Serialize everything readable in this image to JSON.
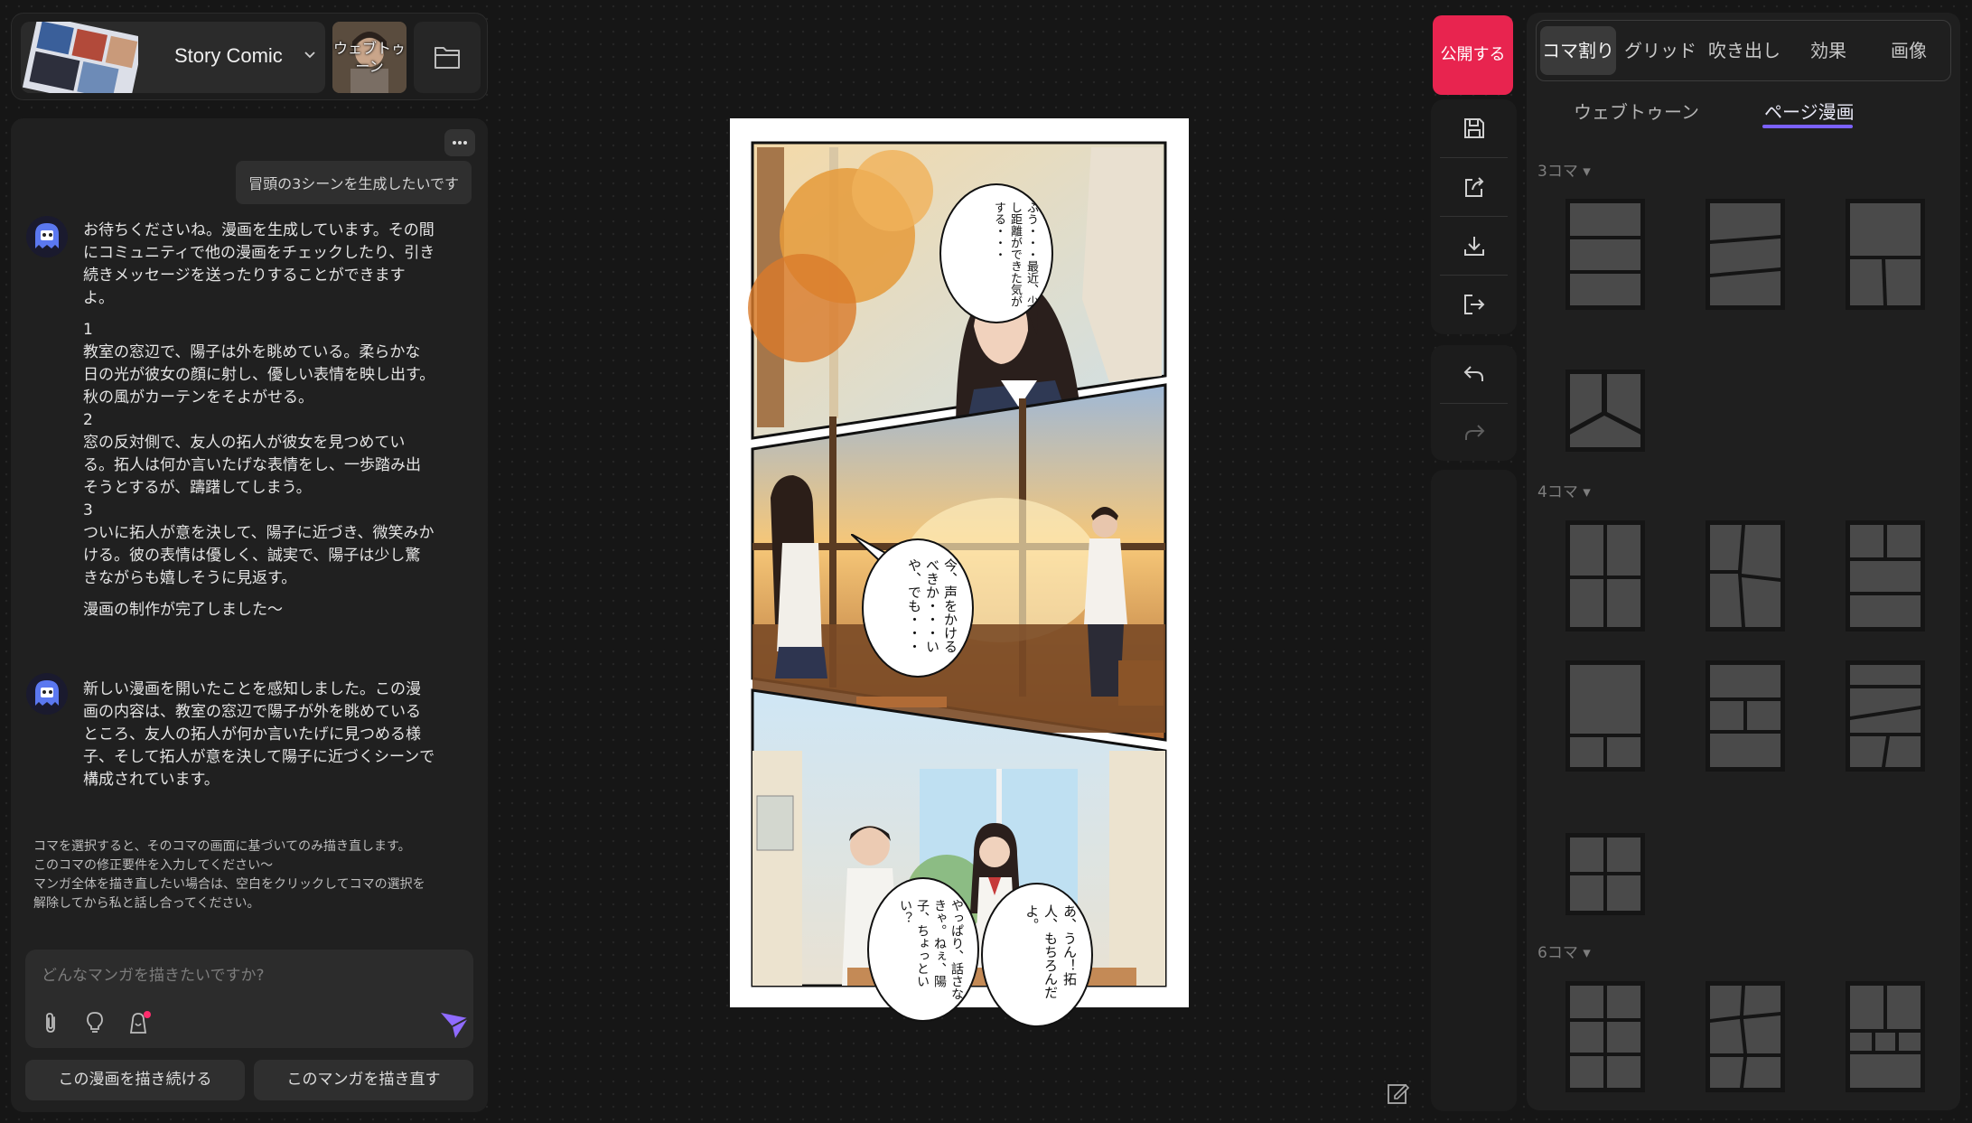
{
  "topbar": {
    "project_name": "Story Comic",
    "mode_label": "ウェブトゥーン"
  },
  "chat": {
    "user_message": "冒頭の3シーンを生成したいです",
    "bot_message_1": {
      "intro": "お待ちくださいね。漫画を生成しています。その間にコミュニティで他の漫画をチェックしたり、引き続きメッセージを送ったりすることができますよ。",
      "steps": [
        "1",
        "教室の窓辺で、陽子は外を眺めている。柔らかな日の光が彼女の顔に射し、優しい表情を映し出す。秋の風がカーテンをそよがせる。",
        "2",
        "窓の反対側で、友人の拓人が彼女を見つめている。拓人は何か言いたげな表情をし、一歩踏み出そうとするが、躊躇してしまう。",
        "3",
        "ついに拓人が意を決して、陽子に近づき、微笑みかける。彼の表情は優しく、誠実で、陽子は少し驚きながらも嬉しそうに見返す。"
      ],
      "done": "漫画の制作が完了しました～"
    },
    "bot_message_2": "新しい漫画を開いたことを感知しました。この漫画の内容は、教室の窓辺で陽子が外を眺めているところ、友人の拓人が何か言いたげに見つめる様子、そして拓人が意を決して陽子に近づくシーンで構成されています。",
    "hint": [
      "コマを選択すると、そのコマの画面に基づいてのみ描き直します。",
      "このコマの修正要件を入力してください～",
      "マンガ全体を描き直したい場合は、空白をクリックしてコマの選択を",
      "解除してから私と話し合ってください。"
    ],
    "input_placeholder": "どんなマンガを描きたいですか?",
    "continue_button": "この漫画を描き続ける",
    "redraw_button": "このマンガを描き直す"
  },
  "comic": {
    "panel1_bubble": "ふう・・・最近、少し距離ができた気がする・・・",
    "panel2_bubble": "今、声をかけるべきか・・・いや、でも・・・",
    "panel3_bubble_a": "やっぱり、話さなきゃ。ねぇ、陽子、ちょっといい？",
    "panel3_bubble_b": "あ、うん！拓人、もちろんだよ。"
  },
  "toolbar": {
    "publish_label": "公開する"
  },
  "layout_panel": {
    "tabs": [
      "コマ割り",
      "グリッド",
      "吹き出し",
      "効果",
      "画像"
    ],
    "active_tab": "コマ割り",
    "subtabs": [
      "ウェブトゥーン",
      "ページ漫画"
    ],
    "active_subtab": "ページ漫画",
    "sections": [
      {
        "label": "3コマ ▾",
        "count": 4
      },
      {
        "label": "4コマ ▾",
        "count": 7
      },
      {
        "label": "6コマ ▾",
        "count": 3
      }
    ]
  },
  "colors": {
    "accent": "#e8244f",
    "tab_underline": "#7b61ff",
    "notification_dot": "#ff2d6d",
    "send_icon": "#8f6bff"
  }
}
